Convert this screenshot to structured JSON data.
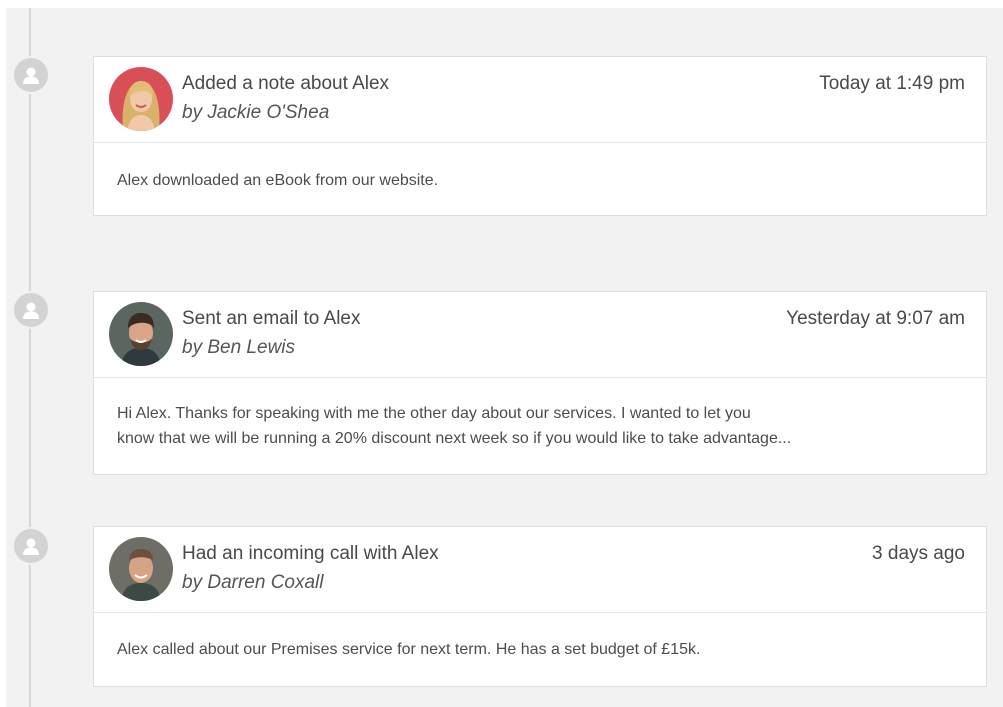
{
  "feed": {
    "items": [
      {
        "title": "Added a note about Alex",
        "author": "by Jackie O'Shea",
        "time": "Today at 1:49 pm",
        "body": "Alex downloaded an eBook from our website.",
        "avatar": "jackie-avatar"
      },
      {
        "title": "Sent an email to Alex",
        "author": "by Ben Lewis",
        "time": "Yesterday at 9:07 am",
        "body_lines": [
          "Hi Alex. Thanks for speaking with me the other day about our services. I wanted to let you",
          "know that we will be running a 20% discount next week so if you would like to take advantage..."
        ],
        "avatar": "ben-avatar"
      },
      {
        "title": "Had an incoming call with Alex",
        "author": "by Darren Coxall",
        "time": "3 days ago",
        "body": "Alex called about our Premises service for next term. He has a set budget of £15k.",
        "avatar": "darren-avatar"
      }
    ]
  },
  "icons": {
    "timeline_marker": "user-icon"
  },
  "colors": {
    "background": "#f2f2f2",
    "card": "#ffffff",
    "marker": "#d3d3d3",
    "text": "#4a4a4a"
  }
}
